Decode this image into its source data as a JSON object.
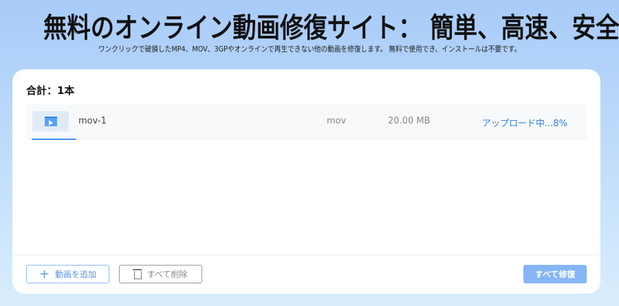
{
  "header": {
    "title": "無料のオンライン動画修復サイト： 簡単、高速、安全",
    "subtitle": "ワンクリックで破損したMP4、MOV、3GPやオンラインで再生できない他の動画を修復します。 無料で使用でき、インストールは不要です。"
  },
  "list": {
    "total_label": "合計：1本",
    "files": [
      {
        "name": "mov-1",
        "type": "mov",
        "size": "20.00 MB",
        "status": "アップロード中...8%",
        "progress_percent": 8,
        "icon": "video-file-icon"
      }
    ]
  },
  "actions": {
    "add_label": "動画を追加",
    "delete_all_label": "すべて削除",
    "repair_all_label": "すべて修復"
  },
  "colors": {
    "accent": "#2f7fe0",
    "repair_button": "#86b6f6"
  }
}
